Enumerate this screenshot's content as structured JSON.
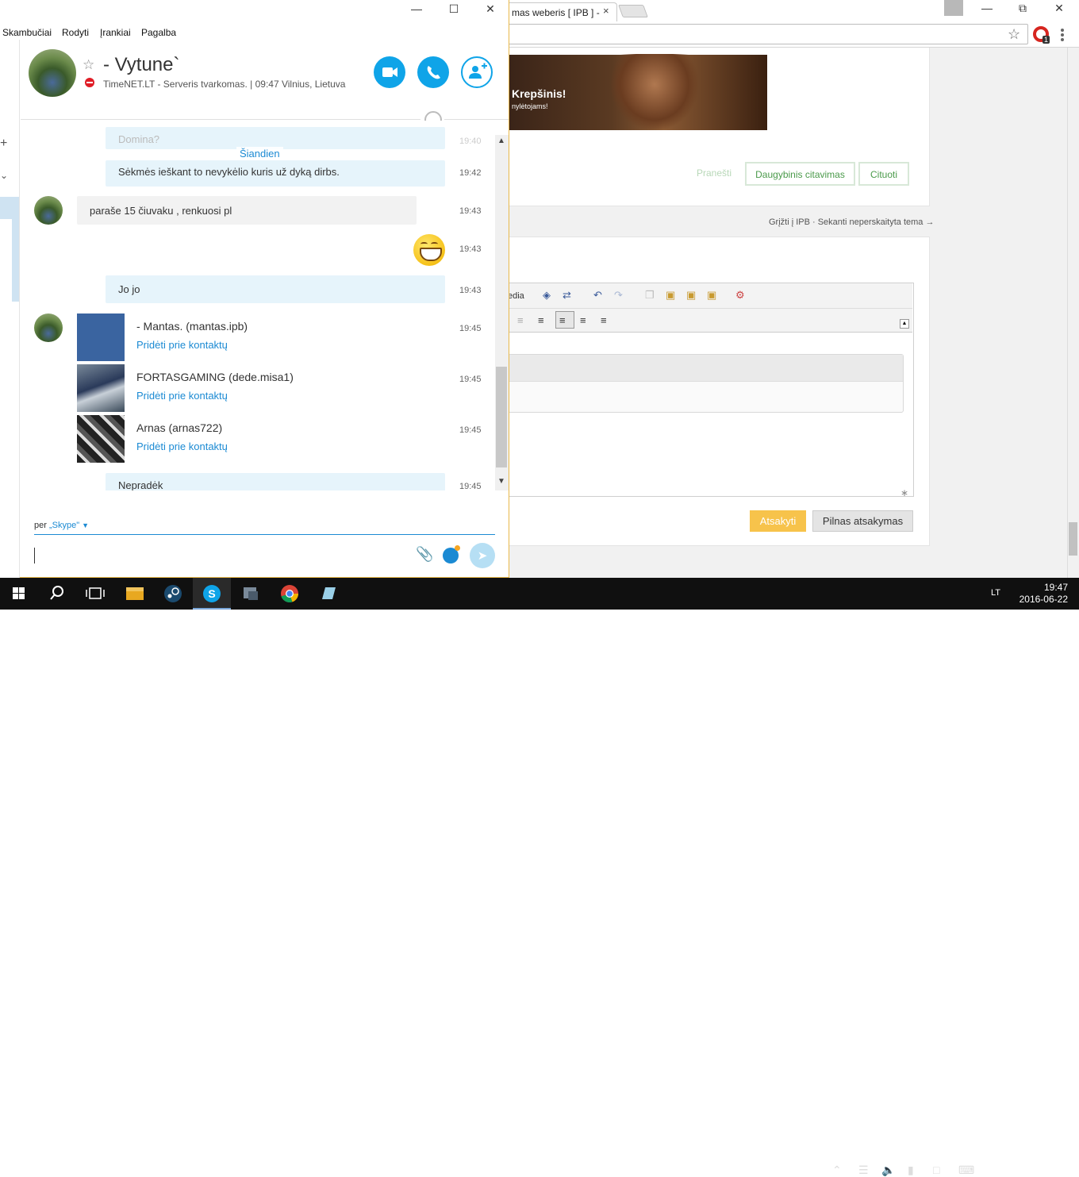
{
  "browser": {
    "tab_title": "mas weberis [ IPB ] -",
    "tab_close": "×",
    "page": {
      "banner_title": "Krepšinis!",
      "banner_subtitle": "nylėtojams!",
      "report_link": "Pranešti",
      "multi_quote_button": "Daugybinis citavimas",
      "quote_button": "Cituoti",
      "nav_line": "Grįžti į IPB · Sekanti neperskaityta tema →",
      "editor_media_label": "edia",
      "submit_button": "Atsakyti",
      "full_reply_button": "Pilnas atsakymas",
      "opera_badge": "1"
    }
  },
  "skype": {
    "menu": [
      "Skambučiai",
      "Rodyti",
      "Įrankiai",
      "Pagalba"
    ],
    "contact": {
      "name": "- Vytune`",
      "status_text": "TimeNET.LT - Serveris tvarkomas.  |  09:47 Vilnius, Lietuva"
    },
    "today_label": "Šiandien",
    "messages": [
      {
        "text": "Domina?",
        "time": "19:40"
      },
      {
        "text": "Sėkmės ieškant to nevykėlio kuris už dyką dirbs.",
        "time": "19:42"
      },
      {
        "text": "paraše 15 čiuvaku , renkuosi pl",
        "time": "19:43"
      },
      {
        "text": "",
        "time": "19:43"
      },
      {
        "text": "Jo jo",
        "time": "19:43"
      },
      {
        "text": "Nepradėk",
        "time": "19:45"
      }
    ],
    "contact_cards": [
      {
        "name": "- Mantas. (mantas.ipb)",
        "link": "Pridėti prie kontaktų",
        "time": "19:45"
      },
      {
        "name": "FORTASGAMING (dede.misa1)",
        "link": "Pridėti prie kontaktų",
        "time": "19:45"
      },
      {
        "name": "Arnas (arnas722)",
        "link": "Pridėti prie kontaktų",
        "time": "19:45"
      }
    ],
    "compose": {
      "via_prefix": "per",
      "via_service": "„Skype\"",
      "input_value": ""
    }
  },
  "taskbar": {
    "language": "LT",
    "time": "19:47",
    "date": "2016-06-22"
  },
  "colors": {
    "skype_blue": "#0fa4e8",
    "link_blue": "#1b8ad3",
    "bubble_out": "#e6f4fb",
    "status_dnd": "#e01d26",
    "submit_yellow": "#f7c34b"
  }
}
